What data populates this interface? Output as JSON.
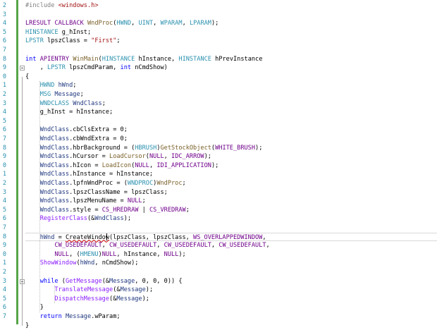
{
  "editor": {
    "line_numbers": [
      "2",
      "3",
      "4",
      "5",
      "6",
      "7",
      "8",
      "9",
      "0",
      "1",
      "2",
      "3",
      "4",
      "5",
      "6",
      "7",
      "8",
      "9",
      "0",
      "1",
      "2",
      "3",
      "4",
      "5",
      "6",
      "7",
      "8",
      "9",
      "0",
      "1",
      "2",
      "3",
      "4",
      "5",
      "6",
      "7"
    ],
    "lines": [
      [
        [
          "p",
          "#include "
        ],
        [
          "s",
          "<windows.h>"
        ]
      ],
      [],
      [
        [
          "m",
          "LRESULT"
        ],
        [
          "t",
          " "
        ],
        [
          "m",
          "CALLBACK"
        ],
        [
          "t",
          " "
        ],
        [
          "f",
          "WndProc"
        ],
        [
          "t",
          "("
        ],
        [
          "ty",
          "HWND"
        ],
        [
          "t",
          ", "
        ],
        [
          "ty",
          "UINT"
        ],
        [
          "t",
          ", "
        ],
        [
          "ty",
          "WPARAM"
        ],
        [
          "t",
          ", "
        ],
        [
          "ty",
          "LPARAM"
        ],
        [
          "t",
          ");"
        ]
      ],
      [
        [
          "ty",
          "HINSTANCE"
        ],
        [
          "t",
          " g_hInst;"
        ]
      ],
      [
        [
          "ty",
          "LPSTR"
        ],
        [
          "t",
          " lpszClass = "
        ],
        [
          "s",
          "\"First\""
        ],
        [
          "t",
          ";"
        ]
      ],
      [],
      [
        [
          "k",
          "int"
        ],
        [
          "t",
          " "
        ],
        [
          "m",
          "APIENTRY"
        ],
        [
          "t",
          " "
        ],
        [
          "f",
          "WinMain"
        ],
        [
          "t",
          "("
        ],
        [
          "ty",
          "HINSTANCE"
        ],
        [
          "t",
          " hInstance, "
        ],
        [
          "ty",
          "HINSTANCE"
        ],
        [
          "t",
          " hPrevInstance"
        ]
      ],
      [
        [
          "t",
          "    , "
        ],
        [
          "ty",
          "LPSTR"
        ],
        [
          "t",
          " lpszCmdParam, "
        ],
        [
          "k",
          "int"
        ],
        [
          "t",
          " nCmdShow)"
        ]
      ],
      [
        [
          "t",
          "{"
        ]
      ],
      [
        [
          "t",
          "    "
        ],
        [
          "ty",
          "HWND"
        ],
        [
          "t",
          " "
        ],
        [
          "n",
          "hWnd"
        ],
        [
          "t",
          ";"
        ]
      ],
      [
        [
          "t",
          "    "
        ],
        [
          "ty",
          "MSG"
        ],
        [
          "t",
          " "
        ],
        [
          "n",
          "Message"
        ],
        [
          "t",
          ";"
        ]
      ],
      [
        [
          "t",
          "    "
        ],
        [
          "ty",
          "WNDCLASS"
        ],
        [
          "t",
          " "
        ],
        [
          "n",
          "WndClass"
        ],
        [
          "t",
          ";"
        ]
      ],
      [
        [
          "t",
          "    g_hInst = hInstance;"
        ]
      ],
      [],
      [
        [
          "t",
          "    "
        ],
        [
          "n",
          "WndClass"
        ],
        [
          "t",
          ".cbClsExtra = 0;"
        ]
      ],
      [
        [
          "t",
          "    "
        ],
        [
          "n",
          "WndClass"
        ],
        [
          "t",
          ".cbWndExtra = 0;"
        ]
      ],
      [
        [
          "t",
          "    "
        ],
        [
          "n",
          "WndClass"
        ],
        [
          "t",
          ".hbrBackground = ("
        ],
        [
          "ty",
          "HBRUSH"
        ],
        [
          "t",
          ")"
        ],
        [
          "f",
          "GetStockObject"
        ],
        [
          "t",
          "("
        ],
        [
          "m",
          "WHITE_BRUSH"
        ],
        [
          "t",
          ");"
        ]
      ],
      [
        [
          "t",
          "    "
        ],
        [
          "n",
          "WndClass"
        ],
        [
          "t",
          ".hCursor = "
        ],
        [
          "f",
          "LoadCursor"
        ],
        [
          "t",
          "("
        ],
        [
          "m",
          "NULL"
        ],
        [
          "t",
          ", "
        ],
        [
          "m",
          "IDC_ARROW"
        ],
        [
          "t",
          ");"
        ]
      ],
      [
        [
          "t",
          "    "
        ],
        [
          "n",
          "WndClass"
        ],
        [
          "t",
          ".hIcon = "
        ],
        [
          "f",
          "LoadIcon"
        ],
        [
          "t",
          "("
        ],
        [
          "m",
          "NULL"
        ],
        [
          "t",
          ", "
        ],
        [
          "m",
          "IDI_APPLICATION"
        ],
        [
          "t",
          ");"
        ]
      ],
      [
        [
          "t",
          "    "
        ],
        [
          "n",
          "WndClass"
        ],
        [
          "t",
          ".hInstance = hInstance;"
        ]
      ],
      [
        [
          "t",
          "    "
        ],
        [
          "n",
          "WndClass"
        ],
        [
          "t",
          ".lpfnWndProc = ("
        ],
        [
          "ty",
          "WNDPROC"
        ],
        [
          "t",
          ")"
        ],
        [
          "f",
          "WndProc"
        ],
        [
          "t",
          ";"
        ]
      ],
      [
        [
          "t",
          "    "
        ],
        [
          "n",
          "WndClass"
        ],
        [
          "t",
          ".lpszClassName = lpszClass;"
        ]
      ],
      [
        [
          "t",
          "    "
        ],
        [
          "n",
          "WndClass"
        ],
        [
          "t",
          ".lpszMenuName = "
        ],
        [
          "m",
          "NULL"
        ],
        [
          "t",
          ";"
        ]
      ],
      [
        [
          "t",
          "    "
        ],
        [
          "n",
          "WndClass"
        ],
        [
          "t",
          ".style = "
        ],
        [
          "m",
          "CS_HREDRAW"
        ],
        [
          "t",
          " | "
        ],
        [
          "m",
          "CS_VREDRAW"
        ],
        [
          "t",
          ";"
        ]
      ],
      [
        [
          "t",
          "    "
        ],
        [
          "g",
          "RegisterClass"
        ],
        [
          "t",
          "(&"
        ],
        [
          "n",
          "WndClass"
        ],
        [
          "t",
          ");"
        ]
      ],
      [],
      [
        [
          "t",
          "    "
        ],
        [
          "n",
          "hWnd"
        ],
        [
          "t",
          " = "
        ],
        [
          "u",
          "CreateWindow"
        ],
        [
          "t",
          "(lpszClass, lpszClass, "
        ],
        [
          "m",
          "WS_OVERLAPPEDWINDOW"
        ],
        [
          "t",
          ","
        ]
      ],
      [
        [
          "t",
          "        "
        ],
        [
          "m",
          "CW_USEDEFAULT"
        ],
        [
          "t",
          ", "
        ],
        [
          "m",
          "CW_USEDEFAULT"
        ],
        [
          "t",
          ", "
        ],
        [
          "m",
          "CW_USEDEFAULT"
        ],
        [
          "t",
          ", "
        ],
        [
          "m",
          "CW_USEDEFAULT"
        ],
        [
          "t",
          ","
        ]
      ],
      [
        [
          "t",
          "        "
        ],
        [
          "m",
          "NULL"
        ],
        [
          "t",
          ", ("
        ],
        [
          "ty",
          "HMENU"
        ],
        [
          "t",
          ")"
        ],
        [
          "m",
          "NULL"
        ],
        [
          "t",
          ", hInstance, "
        ],
        [
          "m",
          "NULL"
        ],
        [
          "t",
          ");"
        ]
      ],
      [
        [
          "t",
          "    "
        ],
        [
          "g",
          "ShowWindow"
        ],
        [
          "t",
          "("
        ],
        [
          "n",
          "hWnd"
        ],
        [
          "t",
          ", nCmdShow);"
        ]
      ],
      [],
      [
        [
          "t",
          "    "
        ],
        [
          "k",
          "while"
        ],
        [
          "t",
          " ("
        ],
        [
          "g",
          "GetMessage"
        ],
        [
          "t",
          "(&"
        ],
        [
          "n",
          "Message"
        ],
        [
          "t",
          ", 0, 0, 0)) {"
        ]
      ],
      [
        [
          "t",
          "        "
        ],
        [
          "g",
          "TranslateMessage"
        ],
        [
          "t",
          "(&"
        ],
        [
          "n",
          "Message"
        ],
        [
          "t",
          ");"
        ]
      ],
      [
        [
          "t",
          "        "
        ],
        [
          "g",
          "DispatchMessage"
        ],
        [
          "t",
          "(&"
        ],
        [
          "n",
          "Message"
        ],
        [
          "t",
          ");"
        ]
      ],
      [
        [
          "t",
          "    }"
        ]
      ],
      [
        [
          "t",
          "    "
        ],
        [
          "k",
          "return"
        ],
        [
          "t",
          " "
        ],
        [
          "n",
          "Message"
        ],
        [
          "t",
          ".wParam;"
        ]
      ],
      [
        [
          "t",
          "}"
        ]
      ]
    ]
  }
}
